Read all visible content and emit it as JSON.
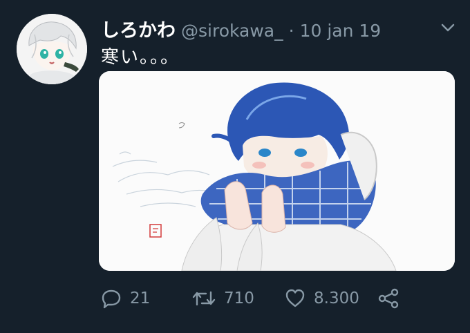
{
  "tweet": {
    "display_name": "しろかわ",
    "handle": "@sirokawa_",
    "separator": "·",
    "timestamp": "10 jan 19",
    "text": "寒い。。。"
  },
  "actions": {
    "reply_count": "21",
    "retweet_count": "710",
    "like_count": "8.300"
  },
  "colors": {
    "background": "#15202b",
    "secondary_text": "#8899a6",
    "primary_text": "#ffffff"
  },
  "icons": {
    "reply": "reply-icon",
    "retweet": "retweet-icon",
    "like": "heart-icon",
    "share": "share-icon",
    "caret": "chevron-down-icon"
  }
}
